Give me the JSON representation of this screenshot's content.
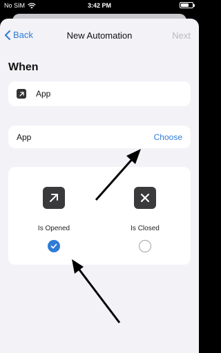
{
  "status_bar": {
    "carrier": "No SIM",
    "time": "3:42 PM",
    "battery_level": 0.7
  },
  "nav": {
    "back_label": "Back",
    "title": "New Automation",
    "next_label": "Next"
  },
  "section": {
    "title": "When"
  },
  "trigger_row": {
    "label": "App"
  },
  "app_row": {
    "label": "App",
    "action": "Choose"
  },
  "options": {
    "opened_label": "Is Opened",
    "closed_label": "Is Closed",
    "opened_selected": true,
    "closed_selected": false
  },
  "colors": {
    "accent": "#2f7bd6",
    "background": "#f2f2f7",
    "card": "#ffffff"
  }
}
